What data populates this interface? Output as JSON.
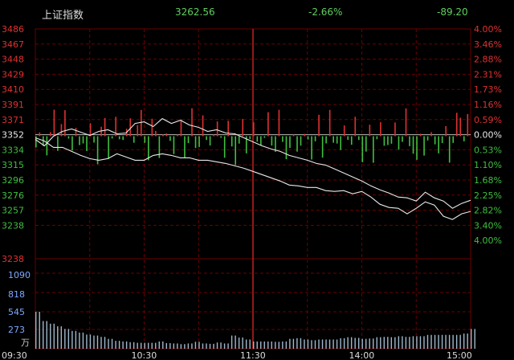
{
  "header": {
    "name": "上证指数",
    "price": "3262.56",
    "change_pct": "-2.66%",
    "change": "-89.20"
  },
  "colors": {
    "up": "#e03030",
    "down": "#3fbf3f",
    "neutral": "#e8e8e8",
    "grid": "#6b0000",
    "volume": "#9fb8cc"
  },
  "chart_data": [
    {
      "type": "line",
      "title": "上证指数",
      "y_ticks": [
        "3486",
        "3467",
        "3448",
        "3429",
        "3410",
        "3391",
        "3371",
        "3352",
        "3334",
        "3315",
        "3296",
        "3276",
        "3257",
        "3238"
      ],
      "pct_ticks": [
        "4.00%",
        "3.46%",
        "2.88%",
        "2.31%",
        "1.73%",
        "1.16%",
        "0.59%",
        "0.00%",
        "0.53%",
        "1.10%",
        "1.68%",
        "2.25%",
        "2.82%",
        "3.40%",
        "4.00%"
      ],
      "x_ticks": [
        "09:30",
        "10:30",
        "11:30",
        "14:00",
        "15:00"
      ],
      "ylim": [
        3218,
        3486
      ],
      "prev_close": 3352,
      "series": [
        {
          "x": [
            0,
            5,
            10,
            15,
            20,
            25,
            30,
            35,
            40,
            45,
            50,
            55,
            60,
            65,
            70,
            75,
            80,
            85,
            90,
            95,
            100,
            105,
            110,
            115,
            120,
            125,
            130,
            135,
            140,
            145,
            150,
            155,
            160,
            165,
            170,
            175,
            180,
            185,
            190,
            195,
            200,
            205,
            210,
            215,
            220,
            225,
            230,
            235,
            240
          ],
          "values": [
            3348,
            3340,
            3352,
            3358,
            3361,
            3357,
            3353,
            3358,
            3360,
            3355,
            3356,
            3368,
            3370,
            3364,
            3374,
            3368,
            3372,
            3366,
            3363,
            3358,
            3360,
            3356,
            3355,
            3350,
            3345,
            3340,
            3336,
            3333,
            3328,
            3325,
            3322,
            3318,
            3316,
            3311,
            3306,
            3301,
            3296,
            3290,
            3285,
            3281,
            3276,
            3275,
            3271,
            3282,
            3275,
            3271,
            3262,
            3268,
            3272
          ]
        },
        {
          "x": [
            0,
            5,
            10,
            15,
            20,
            25,
            30,
            35,
            40,
            45,
            50,
            55,
            60,
            65,
            70,
            75,
            80,
            85,
            90,
            95,
            100,
            105,
            110,
            115,
            120,
            125,
            130,
            135,
            140,
            145,
            150,
            155,
            160,
            165,
            170,
            175,
            180,
            185,
            190,
            195,
            200,
            205,
            210,
            215,
            220,
            225,
            230,
            235,
            240
          ],
          "values": [
            3350,
            3346,
            3338,
            3338,
            3333,
            3328,
            3324,
            3322,
            3324,
            3330,
            3326,
            3322,
            3322,
            3328,
            3330,
            3328,
            3325,
            3325,
            3322,
            3322,
            3320,
            3318,
            3315,
            3312,
            3308,
            3304,
            3300,
            3296,
            3291,
            3290,
            3288,
            3288,
            3284,
            3283,
            3284,
            3280,
            3283,
            3276,
            3267,
            3263,
            3262,
            3255,
            3262,
            3270,
            3266,
            3252,
            3248,
            3255,
            3258
          ]
        }
      ]
    },
    {
      "type": "bar",
      "title": "成交量",
      "y_ticks": [
        "1090",
        "818",
        "545",
        "273"
      ],
      "unit": "万",
      "x": [
        0,
        4,
        8,
        12,
        16,
        20,
        24,
        28,
        32,
        36,
        40,
        44,
        48,
        52,
        56,
        60,
        64,
        68,
        72,
        76,
        80,
        84,
        88,
        92,
        96,
        100,
        104,
        108,
        112,
        116,
        120,
        124,
        128,
        132,
        136,
        140,
        144,
        148,
        152,
        156,
        160,
        164,
        168,
        172,
        176,
        180,
        184,
        188,
        192,
        196,
        200,
        204,
        208,
        212,
        216,
        220,
        224,
        228,
        232,
        236,
        240
      ],
      "values": [
        560,
        420,
        380,
        340,
        300,
        270,
        245,
        215,
        200,
        180,
        150,
        120,
        110,
        100,
        90,
        90,
        90,
        110,
        85,
        80,
        70,
        80,
        105,
        80,
        75,
        95,
        80,
        200,
        170,
        140,
        110,
        110,
        110,
        105,
        110,
        150,
        160,
        140,
        130,
        140,
        140,
        140,
        160,
        175,
        165,
        150,
        155,
        175,
        180,
        175,
        190,
        180,
        190,
        190,
        210,
        210,
        210,
        210,
        210,
        230,
        300
      ]
    }
  ]
}
